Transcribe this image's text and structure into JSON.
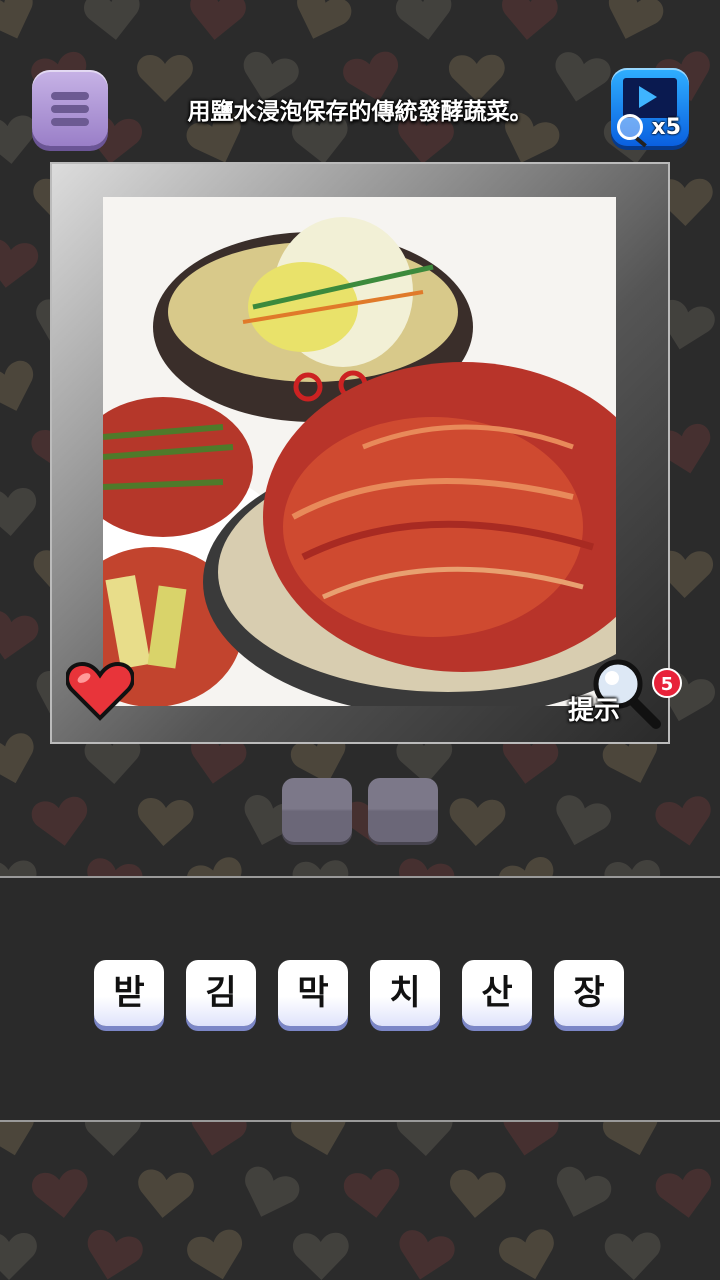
{
  "header": {
    "menu_icon": "hamburger-menu-icon",
    "clue": "用鹽水浸泡保存的傳統發酵蔬菜。",
    "video_button_icon": "video-magnifier-icon",
    "video_button_multiplier": "x5"
  },
  "puzzle": {
    "image_description_icon": "kimchi-photo",
    "life_icon": "heart-icon",
    "hint_label": "提示",
    "hint_count": "5",
    "answer_slots": 2
  },
  "letters": [
    "받",
    "김",
    "막",
    "치",
    "산",
    "장"
  ],
  "colors": {
    "background": "#2b2b2b",
    "menu_button": "#b39ad9",
    "video_button": "#1a8af0",
    "hint_badge": "#e8223a",
    "tile_shadow": "#7b86c7",
    "slot": "#757182"
  }
}
